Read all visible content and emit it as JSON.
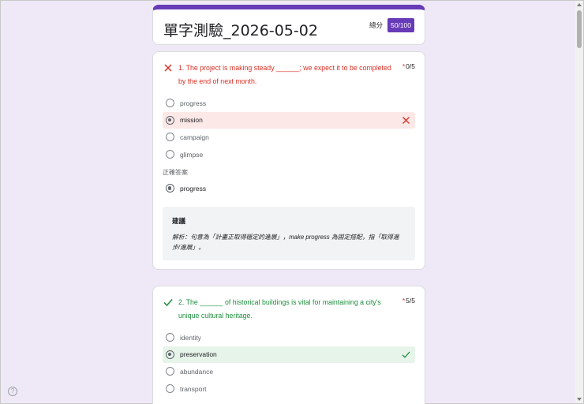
{
  "form": {
    "title": "單字測驗_2026-05-02",
    "score_label": "總分",
    "score_value": "50/100"
  },
  "colors": {
    "accent": "#673ab7",
    "wrong": "#d93025",
    "right": "#1e8e3e",
    "wrong_bg": "#fce8e6",
    "right_bg": "#e6f4ea"
  },
  "questions": [
    {
      "status": "incorrect",
      "status_icon": "x-icon",
      "text": "1. The project is making steady ______; we expect it to be completed by the end of next month.",
      "required_mark": "*",
      "points": "0/5",
      "options": [
        "progress",
        "mission",
        "campaign",
        "glimpse"
      ],
      "selected": "mission",
      "correct_label": "正確答案",
      "correct_answer": "progress",
      "feedback_title": "建議",
      "feedback_text": "解析：句意為「計畫正取得穩定的進展」，make progress 為固定搭配，指「取得進步/進展」。"
    },
    {
      "status": "correct",
      "status_icon": "check-icon",
      "text": "2. The ______ of historical buildings is vital for maintaining a city's unique cultural heritage.",
      "required_mark": "*",
      "points": "5/5",
      "options": [
        "identity",
        "preservation",
        "abundance",
        "transport"
      ],
      "selected": "preservation"
    }
  ],
  "help": {
    "icon": "help-icon",
    "glyph": "?"
  }
}
